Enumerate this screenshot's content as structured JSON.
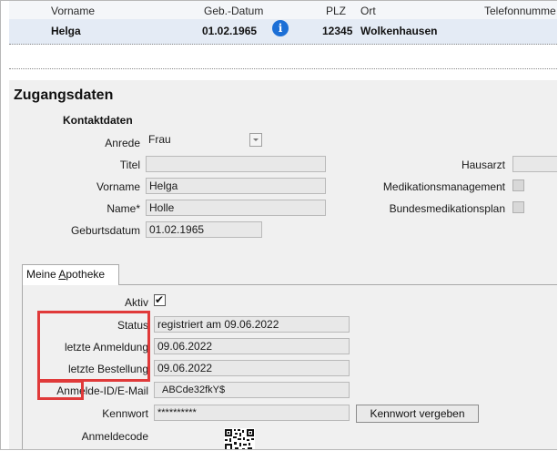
{
  "patient_header": {
    "columns": [
      "Vorname",
      "Geb.-Datum",
      "PLZ",
      "Ort",
      "Telefonnumme"
    ],
    "values": {
      "vorname": "Helga",
      "geburtsdatum": "01.02.1965",
      "plz": "12345",
      "ort": "Wolkenhausen"
    },
    "info_icon": "info-icon"
  },
  "section": {
    "title": "Zugangsdaten",
    "subtitle": "Kontaktdaten"
  },
  "kontakt": {
    "anrede": {
      "label": "Anrede",
      "value": "Frau"
    },
    "titel": {
      "label": "Titel",
      "value": ""
    },
    "vorname": {
      "label": "Vorname",
      "value": "Helga"
    },
    "name": {
      "label": "Name*",
      "value": "Holle"
    },
    "geburtsdatum": {
      "label": "Geburtsdatum",
      "value": "01.02.1965"
    }
  },
  "right_fields": {
    "hausarzt": {
      "label": "Hausarzt",
      "value": ""
    },
    "medikationsmanagement": {
      "label": "Medikationsmanagement",
      "checked": false
    },
    "bundesmedikationsplan": {
      "label": "Bundesmedikationsplan",
      "checked": false
    }
  },
  "tab": {
    "label": "Meine Apotheke"
  },
  "apotheke": {
    "aktiv": {
      "label": "Aktiv",
      "checked": true
    },
    "status": {
      "label": "Status",
      "value": "registriert am 09.06.2022"
    },
    "letzte_anmeldung": {
      "label": "letzte Anmeldung",
      "value": "09.06.2022"
    },
    "letzte_bestellung": {
      "label": "letzte Bestellung",
      "value": "09.06.2022"
    },
    "anmelde_id": {
      "label": "Anmelde-ID/E-Mail",
      "value": "ABCde32fkY$"
    },
    "kennwort": {
      "label": "Kennwort",
      "value": "**********"
    },
    "kennwort_button": "Kennwort vergeben",
    "anmeldecode": {
      "label": "Anmeldecode"
    }
  },
  "highlight_color": "#e03a3a"
}
